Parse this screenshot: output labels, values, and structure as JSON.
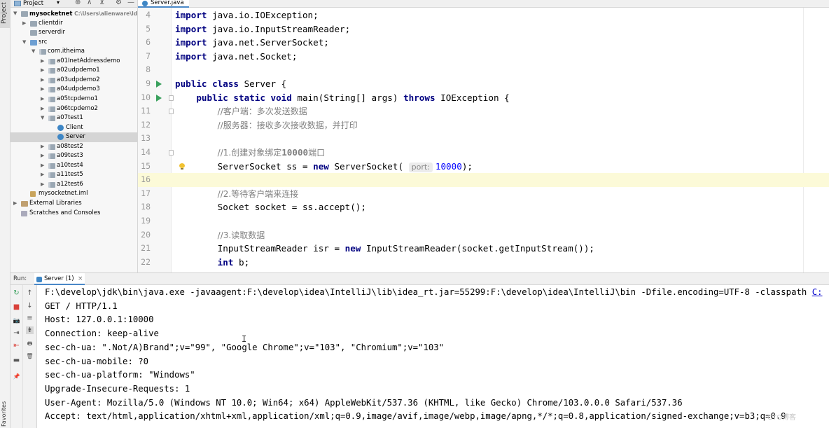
{
  "side_strip": {
    "project_label": "Project",
    "favorites_label": "Favorites"
  },
  "project_panel": {
    "header_title": "Project",
    "header_chevron": "▾",
    "header_icons": [
      "⊕",
      "⊼",
      "⊻",
      "⚙",
      "—"
    ],
    "tree": [
      {
        "label": "mysocketnet",
        "path": "C:\\Users\\alienware\\IdeaP",
        "icon": "folder",
        "expanded": true,
        "bold": true
      },
      {
        "label": "clientdir",
        "icon": "folder",
        "expanded": false
      },
      {
        "label": "serverdir",
        "icon": "folder"
      },
      {
        "label": "src",
        "icon": "src-folder",
        "expanded": true
      },
      {
        "label": "com.itheima",
        "icon": "package",
        "expanded": true
      },
      {
        "label": "a01InetAddressdemo",
        "icon": "package",
        "expanded": false
      },
      {
        "label": "a02udpdemo1",
        "icon": "package",
        "expanded": false
      },
      {
        "label": "a03udpdemo2",
        "icon": "package",
        "expanded": false
      },
      {
        "label": "a04udpdemo3",
        "icon": "package",
        "expanded": false
      },
      {
        "label": "a05tcpdemo1",
        "icon": "package",
        "expanded": false
      },
      {
        "label": "a06tcpdemo2",
        "icon": "package",
        "expanded": false
      },
      {
        "label": "a07test1",
        "icon": "package",
        "expanded": true
      },
      {
        "label": "Client",
        "icon": "java-class"
      },
      {
        "label": "Server",
        "icon": "java-class",
        "selected": true
      },
      {
        "label": "a08test2",
        "icon": "package",
        "expanded": false
      },
      {
        "label": "a09test3",
        "icon": "package",
        "expanded": false
      },
      {
        "label": "a10test4",
        "icon": "package",
        "expanded": false
      },
      {
        "label": "a11test5",
        "icon": "package",
        "expanded": false
      },
      {
        "label": "a12test6",
        "icon": "package",
        "expanded": false
      },
      {
        "label": "mysocketnet.iml",
        "icon": "iml"
      },
      {
        "label": "External Libraries",
        "icon": "libs",
        "expanded": false
      },
      {
        "label": "Scratches and Consoles",
        "icon": "scratch"
      }
    ]
  },
  "editor": {
    "tab_label": "Server.java",
    "current_line": 16,
    "lines": [
      {
        "num": "4",
        "tokens": [
          {
            "t": "import",
            "c": "kw"
          },
          {
            "t": " java.io.IOException;"
          }
        ]
      },
      {
        "num": "5",
        "tokens": [
          {
            "t": "import",
            "c": "kw"
          },
          {
            "t": " java.io.InputStreamReader;"
          }
        ]
      },
      {
        "num": "6",
        "tokens": [
          {
            "t": "import",
            "c": "kw"
          },
          {
            "t": " java.net.ServerSocket;"
          }
        ]
      },
      {
        "num": "7",
        "tokens": [
          {
            "t": "import",
            "c": "kw"
          },
          {
            "t": " java.net.Socket;"
          }
        ]
      },
      {
        "num": "8",
        "tokens": []
      },
      {
        "num": "9",
        "run": true,
        "tokens": [
          {
            "t": "public class",
            "c": "kw"
          },
          {
            "t": " Server {"
          }
        ]
      },
      {
        "num": "10",
        "run": true,
        "fold": true,
        "tokens": [
          {
            "t": "    "
          },
          {
            "t": "public static void",
            "c": "kw"
          },
          {
            "t": " main(String[] args) "
          },
          {
            "t": "throws",
            "c": "kw"
          },
          {
            "t": " IOException {"
          }
        ]
      },
      {
        "num": "11",
        "fold": true,
        "tokens": [
          {
            "t": "        "
          },
          {
            "t": "//客户端：多次发送数据",
            "c": "cm"
          }
        ]
      },
      {
        "num": "12",
        "tokens": [
          {
            "t": "        "
          },
          {
            "t": "//服务器：接收多次接收数据，并打印",
            "c": "cm"
          }
        ]
      },
      {
        "num": "13",
        "tokens": []
      },
      {
        "num": "14",
        "fold": true,
        "tokens": [
          {
            "t": "        "
          },
          {
            "t": "//1.创建对象绑定",
            "c": "cm"
          },
          {
            "t": "10000",
            "c": "cmb"
          },
          {
            "t": "端口",
            "c": "cm"
          }
        ]
      },
      {
        "num": "15",
        "bulb": true,
        "tokens": [
          {
            "t": "        ServerSocket ss = "
          },
          {
            "t": "new",
            "c": "kw"
          },
          {
            "t": " ServerSocket( "
          },
          {
            "t": "port:",
            "c": "hint"
          },
          {
            "t": "10000",
            "c": "num"
          },
          {
            "t": ");"
          }
        ]
      },
      {
        "num": "16",
        "tokens": []
      },
      {
        "num": "17",
        "tokens": [
          {
            "t": "        "
          },
          {
            "t": "//2.等待客户端来连接",
            "c": "cm"
          }
        ]
      },
      {
        "num": "18",
        "tokens": [
          {
            "t": "        Socket socket = ss.accept();"
          }
        ]
      },
      {
        "num": "19",
        "tokens": []
      },
      {
        "num": "20",
        "tokens": [
          {
            "t": "        "
          },
          {
            "t": "//3.读取数据",
            "c": "cm"
          }
        ]
      },
      {
        "num": "21",
        "tokens": [
          {
            "t": "        InputStreamReader isr = "
          },
          {
            "t": "new",
            "c": "kw"
          },
          {
            "t": " InputStreamReader(socket.getInputStream());"
          }
        ]
      },
      {
        "num": "22",
        "tokens": [
          {
            "t": "        "
          },
          {
            "t": "int",
            "c": "kw"
          },
          {
            "t": " b;"
          }
        ]
      }
    ]
  },
  "run_window": {
    "run_label": "Run:",
    "tab_label": "Server (1)",
    "close_glyph": "×",
    "toolbar_left": [
      "↻",
      "■",
      "📷",
      "⇥",
      "⇤",
      "▬",
      "📌"
    ],
    "toolbar_right": [
      "↑",
      "↓",
      "≡",
      "⇟",
      "🖶",
      "🗑"
    ],
    "console_lines": [
      {
        "text": "F:\\develop\\jdk\\bin\\java.exe -javaagent:F:\\develop\\idea\\IntelliJ\\lib\\idea_rt.jar=55299:F:\\develop\\idea\\IntelliJ\\bin -Dfile.encoding=UTF-8 -classpath ",
        "link": "C:"
      },
      {
        "text": "GET / HTTP/1.1"
      },
      {
        "text": "Host: 127.0.0.1:10000"
      },
      {
        "text": "Connection: keep-alive"
      },
      {
        "text": "sec-ch-ua: \".Not/A)Brand\";v=\"99\", \"Google Chrome\";v=\"103\", \"Chromium\";v=\"103\""
      },
      {
        "text": "sec-ch-ua-mobile: ?0"
      },
      {
        "text": "sec-ch-ua-platform: \"Windows\""
      },
      {
        "text": "Upgrade-Insecure-Requests: 1"
      },
      {
        "text": "User-Agent: Mozilla/5.0 (Windows NT 10.0; Win64; x64) AppleWebKit/537.36 (KHTML, like Gecko) Chrome/103.0.0.0 Safari/537.36"
      },
      {
        "text": "Accept: text/html,application/xhtml+xml,application/xml;q=0.9,image/avif,image/webp,image/apng,*/*;q=0.8,application/signed-exchange;v=b3;q=0.9"
      }
    ],
    "text_cursor_glyph": "I"
  },
  "watermark": "CTO博客"
}
